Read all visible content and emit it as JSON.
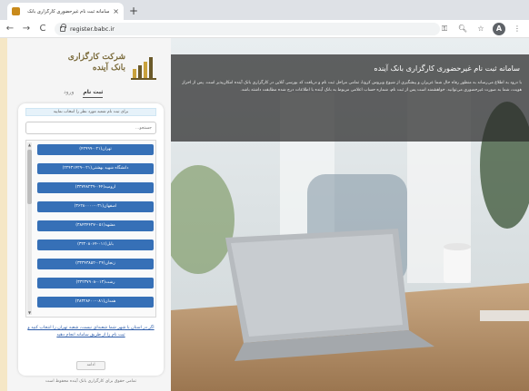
{
  "browser": {
    "tab_title": "سامانه ثبت نام غیرحضوری کارگزاری بانک",
    "tab_close": "×",
    "new_tab": "+",
    "url": "register.babc.ir",
    "nav": {
      "back": "←",
      "forward": "→",
      "reload": "C"
    },
    "tools": {
      "key": "⚿",
      "zoom": "🔍︎",
      "star": "☆",
      "profile": "A",
      "menu": "⋮"
    }
  },
  "brand": {
    "line1": "شرکت کارگزاری",
    "line2": "بانک آینده",
    "colors": {
      "bar_dark": "#6b5a2a",
      "bar_light": "#c9a23c"
    }
  },
  "auth_tabs": [
    "ثبت نام",
    "ورود"
  ],
  "form": {
    "notice": "برای ثبت نام شعبه مورد نظر را انتخاب نمایید",
    "search_placeholder": "جستجو...",
    "branches": [
      "تهران(۰۲۱-۴۲۹۹۹)",
      "دانشگاه شهید بهشتی(۰۲۱-۲۲۴۳۱۴۲۹)",
      "ارومیه(۰۴۴-۳۳۷۴۸۲۳۹)",
      "اصفهان(۰۳۱-۳۶۲۸۰۰۰۰)",
      "مشهد(۰۵۱-۳۸۴۳۴۴۲۷)",
      "بابل(۰۱۱-۳۲۲۰۸۰۶۴)",
      "زنجان(۰۲۴-۳۳۳۴۳۸۵۲)",
      "رشت(۰۱۳-۳۳۲۳۷۹۰۸)",
      "همدان(۰۸۱-۳۸۳۲۸۴۰۰)"
    ],
    "scroll": {
      "up": "▲",
      "down": "▼"
    },
    "help_link": "اگر در استان یا شهر شما شعبه‌ای نیست، شعبه تهران را انتخاب کنید و ثبت نام را از طریق سامانه انجام دهید",
    "confirm_label": "ادامه",
    "footer": "تمامی حقوق برای کارگزاری بانک آینده محفوظ است"
  },
  "hero": {
    "title": "سامانه ثبت نام غیرحضوری کارگزاری بانک آینده",
    "description": "با درود به اطلاع می‌رساند به منظور رفاه حال شما عزیزان و پیشگیری از شیوع ویروس کرونا، تمامی مراحل ثبت نام و دریافت کد بورسی آنلاین در کارگزاری بانک آینده امکان‌پذیر است. پس از احراز هویت، شما به صورت غیرحضوری می‌توانید. خواهشمند است پس از ثبت نام، شماره حساب اعلامی مربوط به بانک آینده با اطلاعات درج شده مطابقت داشته باشد."
  }
}
